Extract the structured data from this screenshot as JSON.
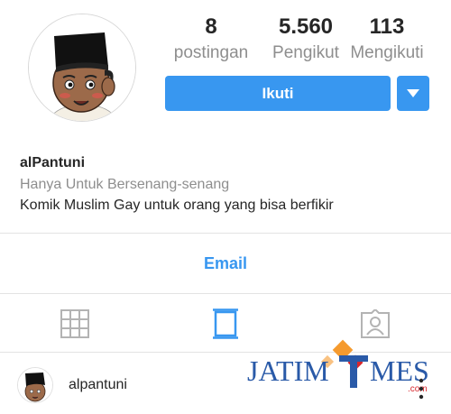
{
  "profile": {
    "posts_count": "8",
    "posts_label": "postingan",
    "followers_count": "5.560",
    "followers_label": "Pengikut",
    "following_count": "113",
    "following_label": "Mengikuti",
    "follow_label": "Ikuti",
    "username": "alPantuni",
    "tagline": "Hanya Untuk Bersenang-senang",
    "bio": "Komik Muslim Gay untuk orang yang bisa berfikir",
    "contact_label": "Email"
  },
  "tabs": [
    {
      "icon": "grid-icon",
      "active": false
    },
    {
      "icon": "feed-icon",
      "active": true
    },
    {
      "icon": "tagged-icon",
      "active": false
    }
  ],
  "post": {
    "username": "alpantuni"
  },
  "watermark": {
    "text_left": "JATIM",
    "text_right": "MES",
    "suffix": ".com"
  },
  "colors": {
    "accent": "#3897f0",
    "muted_text": "#8e8e8e",
    "divider": "#e3e3e3",
    "watermark_blue": "#2a5aa8",
    "watermark_orange": "#f59a2e",
    "watermark_red": "#d8262c"
  }
}
